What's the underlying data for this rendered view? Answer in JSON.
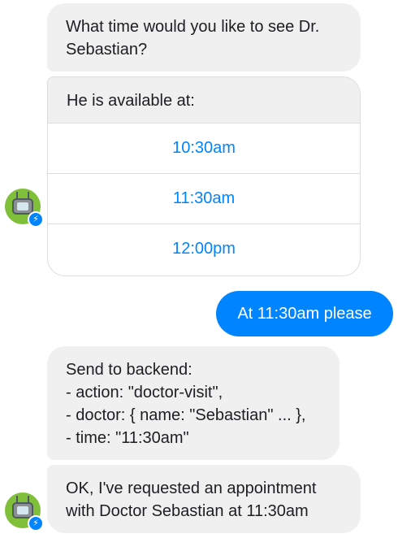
{
  "messages": {
    "bot_question": [
      "What time would you like to see Dr.",
      "Sebastian?"
    ],
    "availability_heading": "He is available at:",
    "time_options": [
      "10:30am",
      "11:30am",
      "12:00pm"
    ],
    "user_reply": "At 11:30am please",
    "backend_payload": [
      "Send to backend:",
      "- action: \"doctor-visit\",",
      "- doctor: { name: \"Sebastian\" ... },",
      "- time: \"11:30am\""
    ],
    "confirmation": [
      "OK, I've requested an appointment",
      "with Doctor Sebastian at 11:30am"
    ]
  },
  "colors": {
    "accent": "#0084ff",
    "bot_bubble": "#f0f0f0",
    "avatar_bg": "#7fbf3a"
  },
  "icons": {
    "avatar": "tv-robot-avatar-icon",
    "badge": "messenger-badge-icon"
  }
}
